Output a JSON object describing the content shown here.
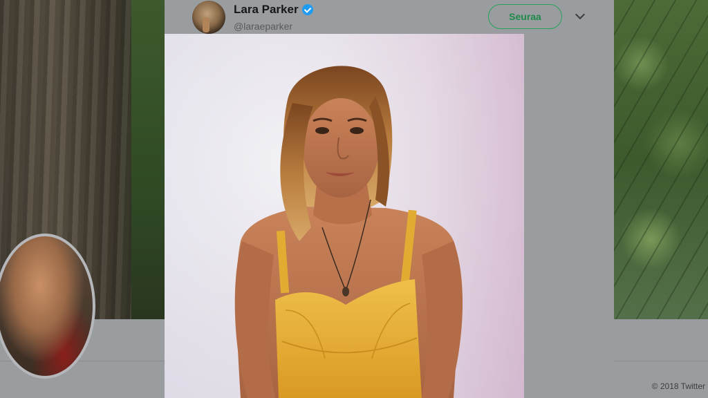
{
  "background": {
    "footer_text": "© 2018 Twitter"
  },
  "tweet": {
    "author": {
      "display_name": "Lara Parker",
      "handle": "@laraeparker",
      "verified": true,
      "verified_icon": "verified-badge-icon"
    },
    "follow_label": "Seuraa",
    "menu_icon": "chevron-down-icon",
    "media": {
      "type": "photo",
      "icon": "photo"
    }
  },
  "colors": {
    "follow_accent": "#27a057",
    "verified_blue": "#1d9bf0",
    "top_color": "#e8b63a"
  }
}
